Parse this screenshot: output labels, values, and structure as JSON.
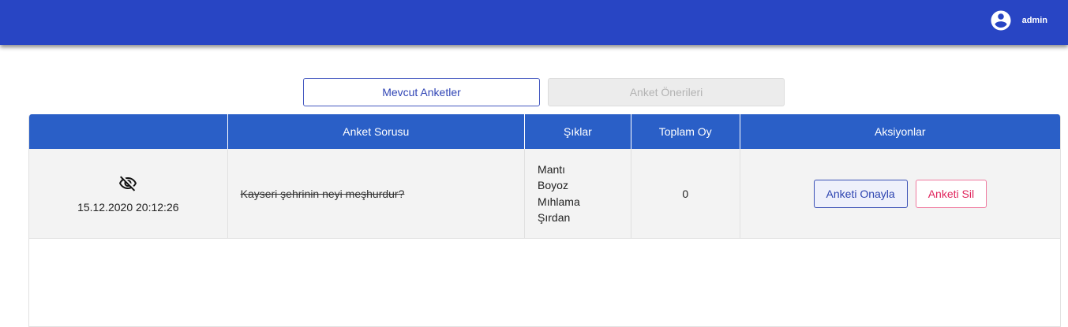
{
  "header": {
    "username": "admin",
    "user_icon": "account-circle-icon",
    "colors": {
      "appbar": "#2845c4"
    }
  },
  "tabs": [
    {
      "label": "Mevcut Anketler",
      "state": "active"
    },
    {
      "label": "Anket Önerileri",
      "state": "disabled"
    }
  ],
  "table": {
    "columns": [
      "",
      "Anket Sorusu",
      "Şıklar",
      "Toplam Oy",
      "Aksiyonlar"
    ],
    "header_color": "#2a5fc7",
    "rows": [
      {
        "status_icon": "eye-off-icon",
        "date": "15.12.2020 20:12:26",
        "question": "Kayseri şehrinin neyi meşhurdur?",
        "options": [
          "Mantı",
          "Boyoz",
          "Mıhlama",
          "Şırdan"
        ],
        "total_votes": "0",
        "approve_label": "Anketi Onayla",
        "delete_label": "Anketi Sil"
      }
    ]
  }
}
